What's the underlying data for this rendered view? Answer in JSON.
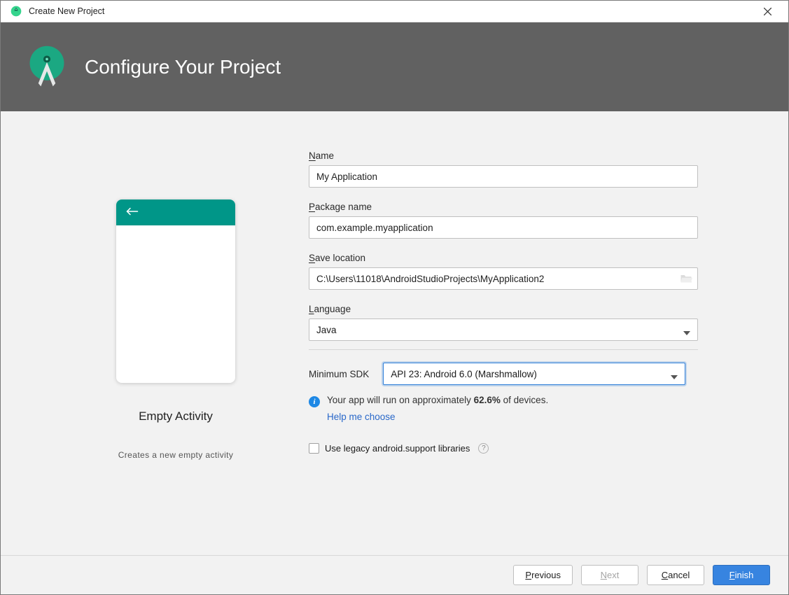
{
  "window": {
    "title": "Create New Project",
    "close_label": "Close"
  },
  "header": {
    "title": "Configure Your Project"
  },
  "preview": {
    "template_name": "Empty Activity",
    "template_desc": "Creates a new empty activity"
  },
  "form": {
    "name": {
      "label_mn": "N",
      "label_rest": "ame",
      "value": "My Application"
    },
    "package": {
      "label_mn": "P",
      "label_rest": "ackage name",
      "value": "com.example.myapplication"
    },
    "save": {
      "label_mn": "S",
      "label_rest": "ave location",
      "value": "C:\\Users\\11018\\AndroidStudioProjects\\MyApplication2"
    },
    "language": {
      "label_mn": "L",
      "label_rest": "anguage",
      "value": "Java"
    },
    "sdk": {
      "label": "Minimum SDK",
      "value": "API 23: Android 6.0 (Marshmallow)"
    },
    "info": {
      "prefix": "Your app will run on approximately ",
      "percent": "62.6%",
      "suffix": " of devices."
    },
    "help_link": "Help me choose",
    "legacy": {
      "label": "Use legacy android.support libraries"
    }
  },
  "footer": {
    "previous_mn": "P",
    "previous_rest": "revious",
    "next_mn": "N",
    "next_rest": "ext",
    "cancel_mn": "C",
    "cancel_rest": "ancel",
    "finish_mn": "F",
    "finish_rest": "inish"
  }
}
